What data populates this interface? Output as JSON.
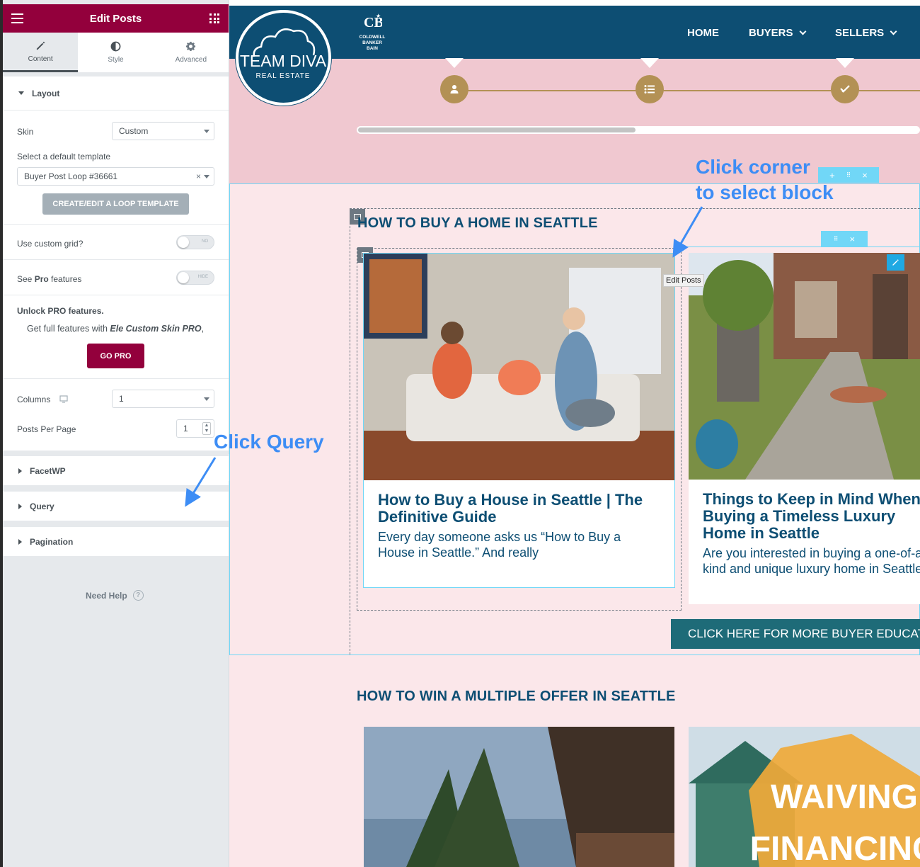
{
  "panel": {
    "title": "Edit Posts",
    "tabs": [
      {
        "label": "Content",
        "icon": "pencil-icon"
      },
      {
        "label": "Style",
        "icon": "half-circle-icon"
      },
      {
        "label": "Advanced",
        "icon": "gear-icon"
      }
    ],
    "layout": {
      "section_label": "Layout",
      "skin_label": "Skin",
      "skin_value": "Custom",
      "template_label": "Select a default template",
      "template_value": "Buyer Post Loop #36661",
      "create_button": "CREATE/EDIT A LOOP TEMPLATE",
      "custom_grid_label": "Use custom grid?",
      "custom_grid_toggle": "NO",
      "see_pro_label_pre": "See ",
      "see_pro_label_bold": "Pro",
      "see_pro_label_post": " features",
      "see_pro_toggle": "HIDE",
      "unlock_title": "Unlock PRO features.",
      "unlock_text_pre": "Get full features with ",
      "unlock_text_em": "Ele Custom Skin PRO",
      "unlock_text_post": ",",
      "go_pro_button": "GO PRO",
      "columns_label": "Columns",
      "columns_value": "1",
      "posts_per_page_label": "Posts Per Page",
      "posts_per_page_value": "1"
    },
    "sections": [
      "FacetWP",
      "Query",
      "Pagination"
    ],
    "need_help": "Need Help",
    "colors": {
      "brand": "#93003c",
      "panel_bg": "#e6e9ec",
      "button_grey": "#a4afb7"
    }
  },
  "site": {
    "logo_main": "TEAM DIVA",
    "logo_sub": "REAL ESTATE",
    "partner_logo": [
      "COLDWELL",
      "BANKER",
      "BAIN"
    ],
    "nav": [
      {
        "label": "HOME",
        "dropdown": false
      },
      {
        "label": "BUYERS",
        "dropdown": true
      },
      {
        "label": "SELLERS",
        "dropdown": true
      }
    ],
    "section1_title": "HOW TO BUY A HOME IN SEATTLE",
    "posts": [
      {
        "title": "How to Buy a House in Seattle | The Definitive Guide",
        "excerpt": "Every day someone asks us “How to Buy a House in Seattle.” And really"
      },
      {
        "title": "Things to Keep in Mind When Buying a Timeless Luxury Home in Seattle",
        "excerpt": "Are you interested in buying a one-of-a-kind and unique luxury home in Seattle?"
      }
    ],
    "more_button": "CLICK HERE FOR MORE BUYER EDUCATION",
    "section2_title": "HOW TO WIN A MULTIPLE OFFER IN SEATTLE",
    "waiving_text": [
      "WAIVING",
      "FINANCING"
    ],
    "edit_tooltip": "Edit Posts",
    "colors": {
      "navy": "#0d4e73",
      "gold": "#b39155",
      "pink": "#fbe7ea",
      "teal": "#1e6b78"
    }
  },
  "annotations": {
    "corner": [
      "Click corner",
      "to select block"
    ],
    "query": "Click Query"
  }
}
